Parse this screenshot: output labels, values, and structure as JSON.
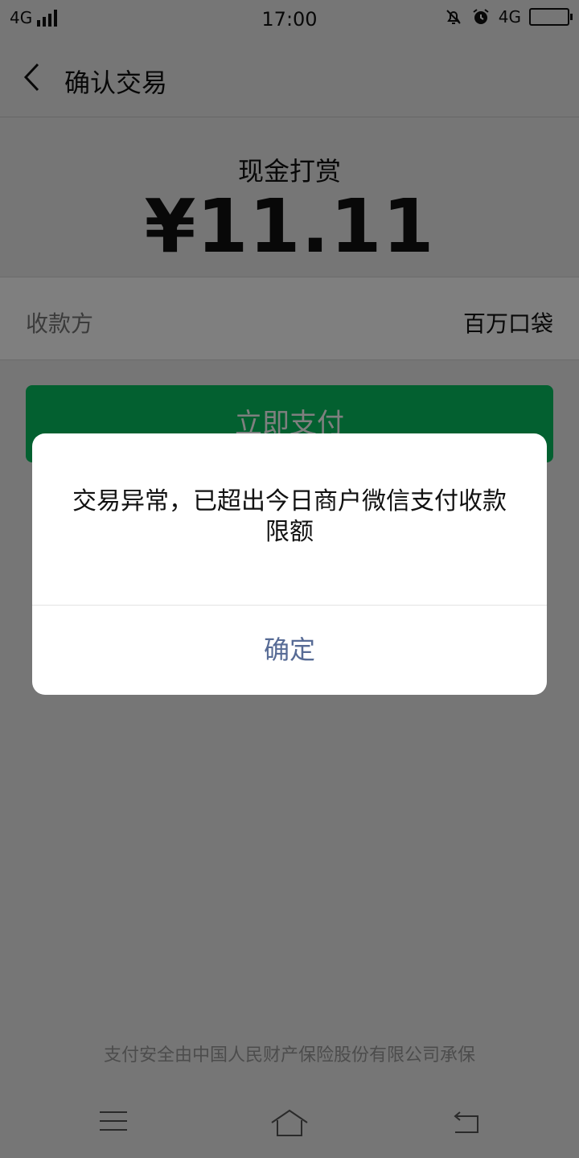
{
  "status_bar": {
    "network_left": "4G",
    "time": "17:00",
    "network_right": "4G"
  },
  "nav": {
    "title": "确认交易"
  },
  "amount": {
    "label": "现金打赏",
    "value": "¥11.11"
  },
  "payee": {
    "label": "收款方",
    "value": "百万口袋"
  },
  "pay_button": {
    "label": "立即支付"
  },
  "dialog": {
    "message": "交易异常，已超出今日商户微信支付收款限额",
    "ok_label": "确定"
  },
  "footer": {
    "note": "支付安全由中国人民财产保险股份有限公司承保"
  },
  "colors": {
    "primary_green": "#07c160",
    "dialog_link": "#576b95"
  },
  "icons": [
    "signal-icon",
    "mute-bell-icon",
    "alarm-icon",
    "battery-icon",
    "back-arrow-icon",
    "menu-icon",
    "home-icon",
    "return-icon"
  ]
}
